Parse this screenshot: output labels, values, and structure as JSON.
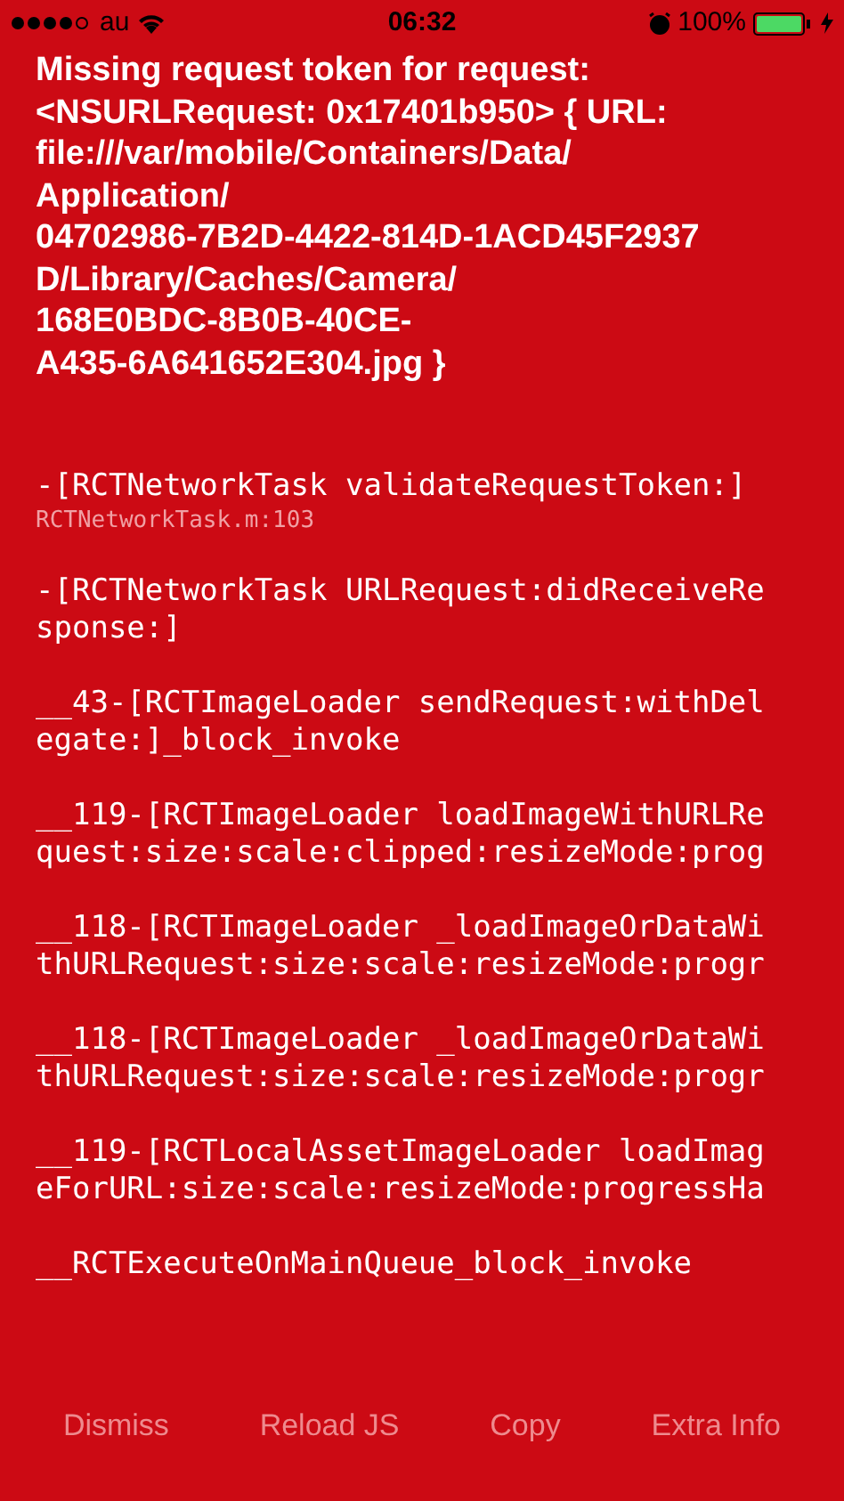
{
  "status_bar": {
    "carrier": "au",
    "time": "06:32",
    "battery": "100%"
  },
  "message": {
    "lines": [
      "Missing request token for request:",
      "<NSURLRequest: 0x17401b950> { URL:",
      "file:///var/mobile/Containers/Data/",
      "Application/",
      "04702986-7B2D-4422-814D-1ACD45F2937",
      "D/Library/Caches/Camera/",
      "168E0BDC-8B0B-40CE-",
      "A435-6A641652E304.jpg }"
    ]
  },
  "stack": [
    {
      "lines": [
        "-[RCTNetworkTask validateRequestToken:]"
      ],
      "file": "RCTNetworkTask.m:103"
    },
    {
      "lines": [
        "-[RCTNetworkTask URLRequest:didReceiveRe",
        "sponse:]"
      ]
    },
    {
      "lines": [
        "__43-[RCTImageLoader sendRequest:withDel",
        "egate:]_block_invoke"
      ]
    },
    {
      "lines": [
        "__119-[RCTImageLoader loadImageWithURLRe",
        "quest:size:scale:clipped:resizeMode:prog"
      ]
    },
    {
      "lines": [
        "__118-[RCTImageLoader _loadImageOrDataWi",
        "thURLRequest:size:scale:resizeMode:progr"
      ]
    },
    {
      "lines": [
        "__118-[RCTImageLoader _loadImageOrDataWi",
        "thURLRequest:size:scale:resizeMode:progr"
      ]
    },
    {
      "lines": [
        "__119-[RCTLocalAssetImageLoader loadImag",
        "eForURL:size:scale:resizeMode:progressHa"
      ]
    },
    {
      "lines": [
        "__RCTExecuteOnMainQueue_block_invoke"
      ]
    }
  ],
  "buttons": [
    "Dismiss",
    "Reload JS",
    "Copy",
    "Extra Info"
  ]
}
